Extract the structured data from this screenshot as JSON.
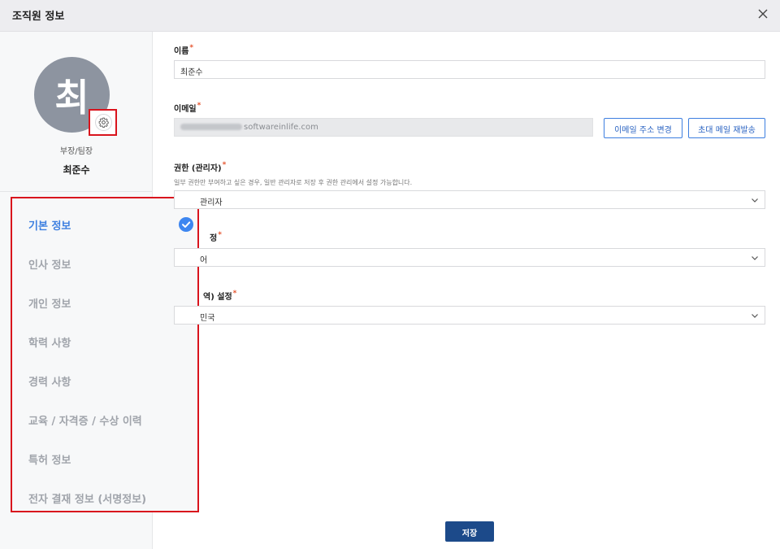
{
  "header": {
    "title": "조직원 정보"
  },
  "profile": {
    "initial": "최",
    "rank": "부장/팀장",
    "name": "최준수"
  },
  "menu": {
    "items": [
      {
        "label": "기본 정보",
        "active": true
      },
      {
        "label": "인사 정보"
      },
      {
        "label": "개인 정보"
      },
      {
        "label": "학력 사항"
      },
      {
        "label": "경력 사항"
      },
      {
        "label": "교육 / 자격증 / 수상 이력"
      },
      {
        "label": "특허 정보"
      },
      {
        "label": "전자 결재 정보 (서명정보)"
      }
    ]
  },
  "form": {
    "name": {
      "label": "이름",
      "value": "최준수"
    },
    "email": {
      "label": "이메일",
      "value_visible": "softwareinlife.com",
      "change_button": "이메일 주소 변경",
      "resend_button": "초대 메일 재발송"
    },
    "permission": {
      "label": "권한 (관리자)",
      "help": "일부 권한만 부여하고 싶은 경우, 일반 관리자로 저장 후 권한 관리에서 설정 가능합니다.",
      "value": "관리자"
    },
    "language": {
      "label_visible": "정",
      "value_visible": "어"
    },
    "region": {
      "label_visible": "역) 설정",
      "value_visible": "민국"
    },
    "save_label": "저장"
  },
  "colors": {
    "accent": "#3d7fe0",
    "save": "#1c4a8a",
    "highlight": "#d9141d"
  }
}
